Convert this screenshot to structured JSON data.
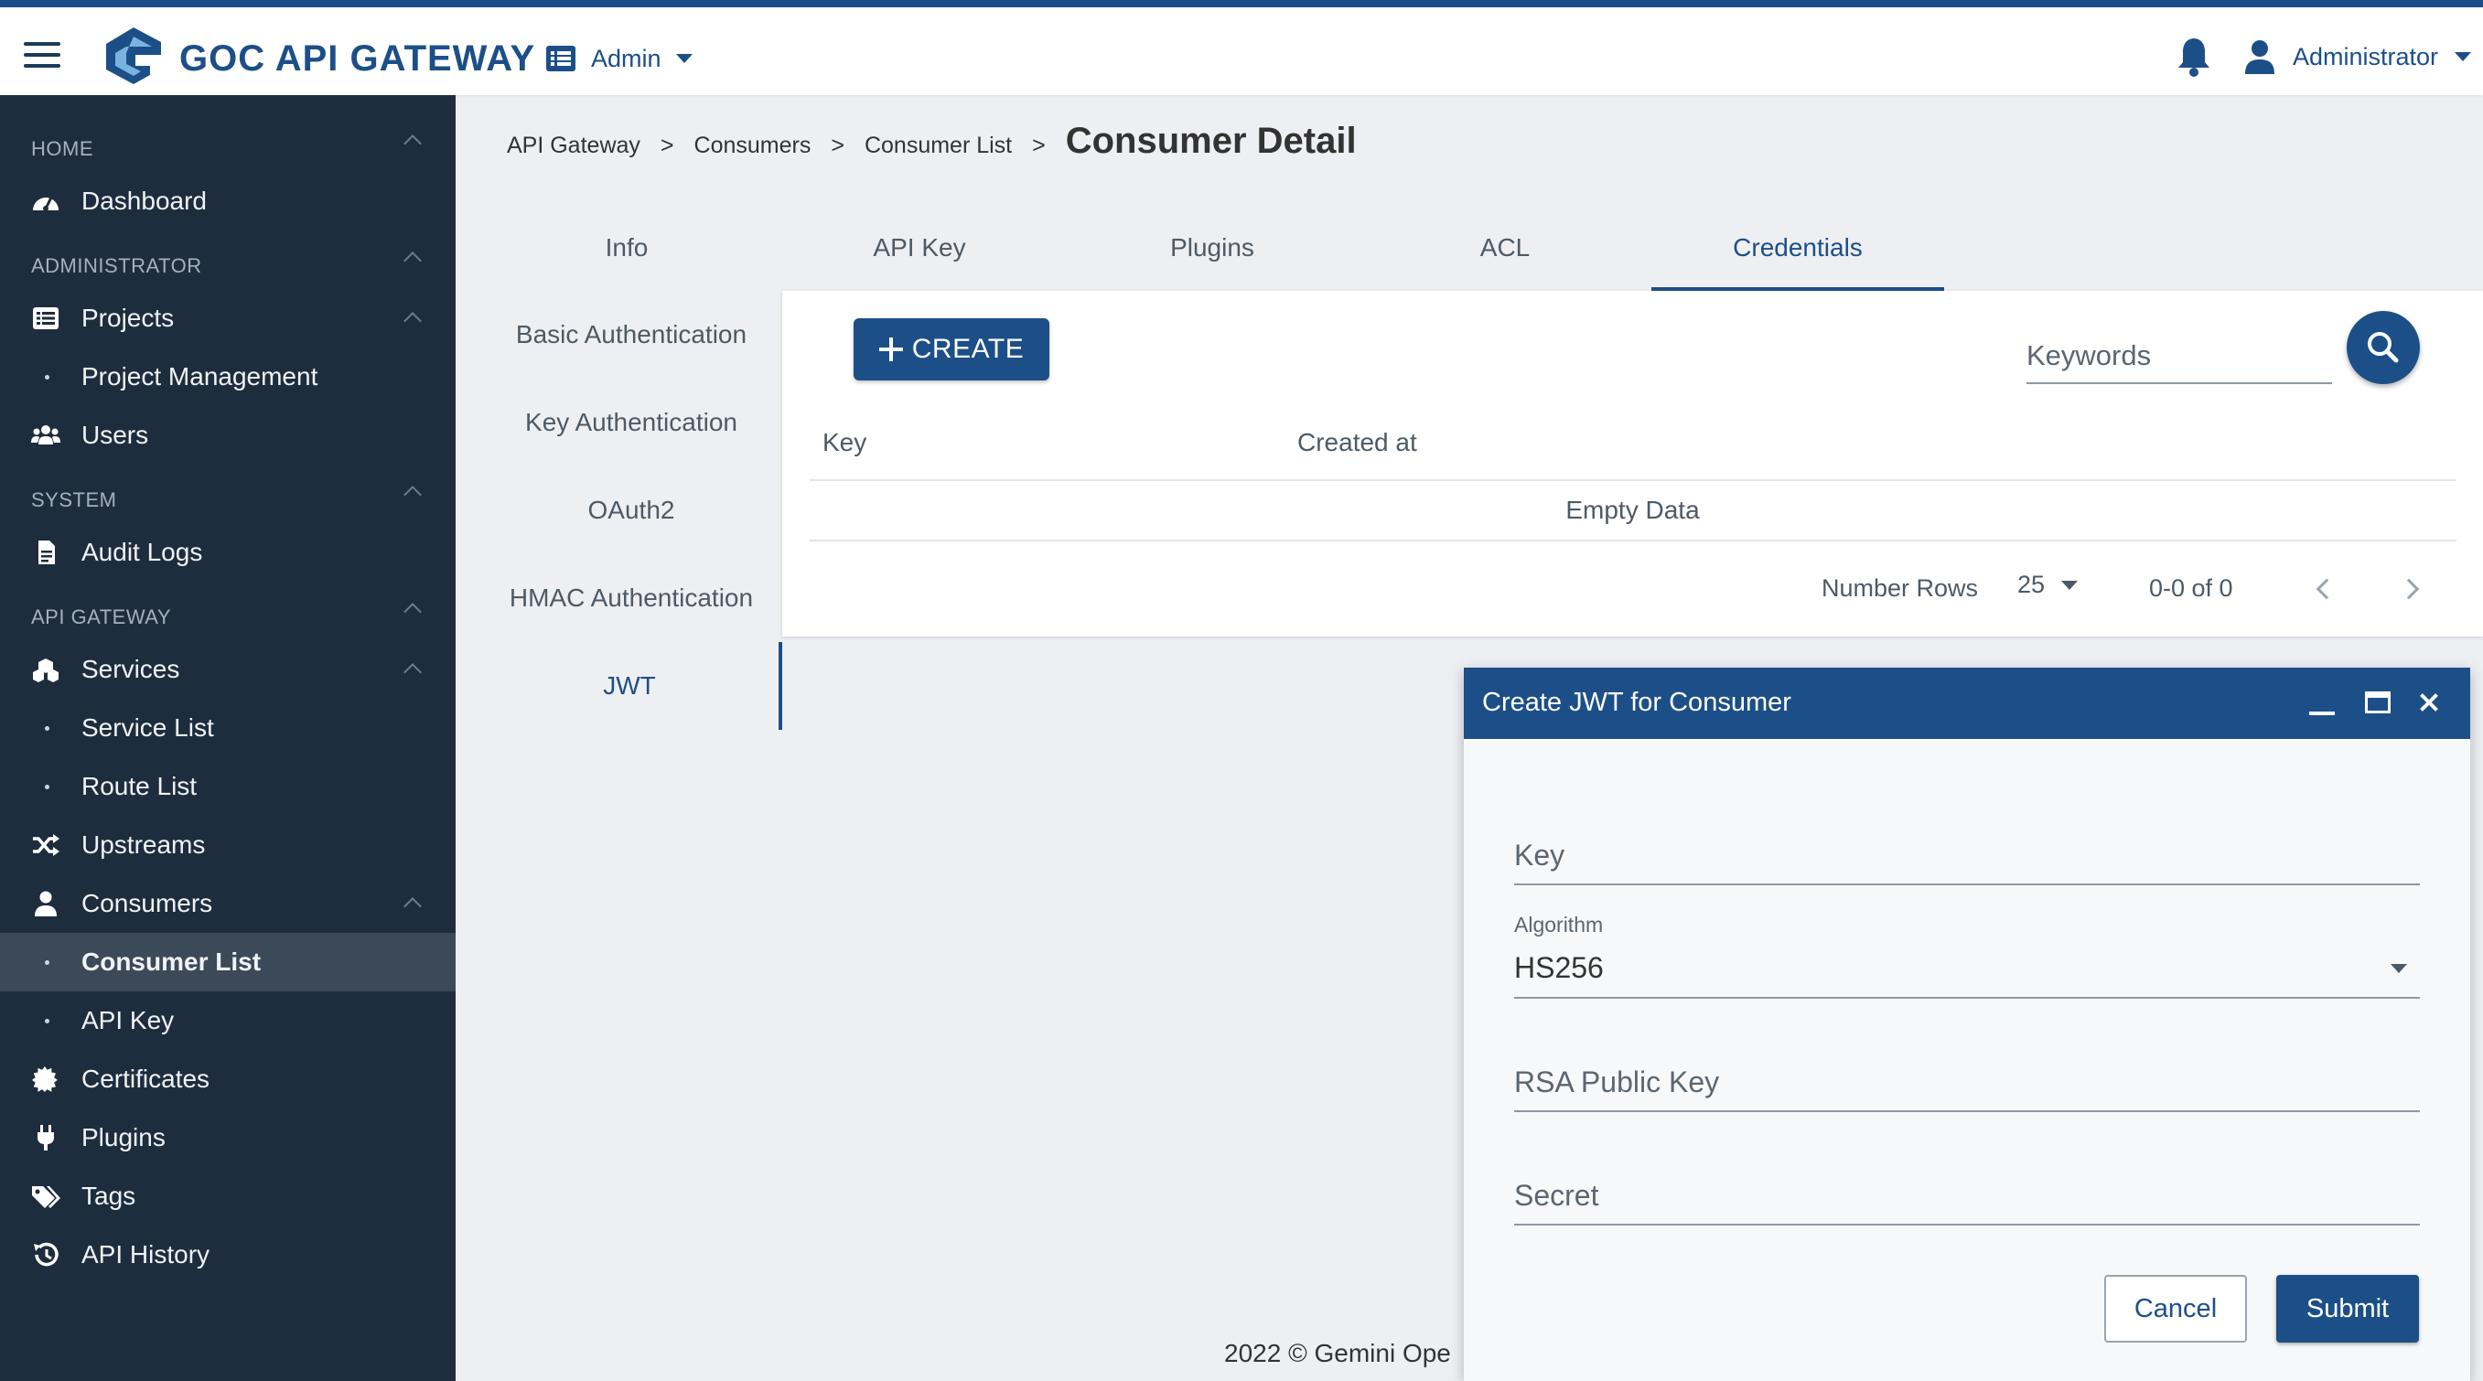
{
  "header": {
    "brand": "GOC API GATEWAY",
    "admin_menu": "Admin",
    "user_menu": "Administrator"
  },
  "sidebar": {
    "sections": [
      {
        "title": "HOME"
      },
      {
        "title": "ADMINISTRATOR"
      },
      {
        "title": "SYSTEM"
      },
      {
        "title": "API GATEWAY"
      }
    ],
    "items": [
      {
        "label": "Dashboard",
        "icon": "dashboard-icon"
      },
      {
        "label": "Projects",
        "icon": "list-icon"
      },
      {
        "label": "Project Management"
      },
      {
        "label": "Users",
        "icon": "users-icon"
      },
      {
        "label": "Audit Logs",
        "icon": "file-icon"
      },
      {
        "label": "Services",
        "icon": "services-icon"
      },
      {
        "label": "Service List"
      },
      {
        "label": "Route List"
      },
      {
        "label": "Upstreams",
        "icon": "shuffle-icon"
      },
      {
        "label": "Consumers",
        "icon": "user-icon"
      },
      {
        "label": "Consumer List",
        "active": true
      },
      {
        "label": "API Key"
      },
      {
        "label": "Certificates",
        "icon": "certificate-icon"
      },
      {
        "label": "Plugins",
        "icon": "plug-icon"
      },
      {
        "label": "Tags",
        "icon": "tags-icon"
      },
      {
        "label": "API History",
        "icon": "history-icon"
      }
    ]
  },
  "breadcrumb": {
    "items": [
      "API Gateway",
      "Consumers",
      "Consumer List"
    ],
    "separator": ">",
    "current": "Consumer Detail"
  },
  "tabs": [
    "Info",
    "API Key",
    "Plugins",
    "ACL",
    "Credentials"
  ],
  "active_tab": "Credentials",
  "vertical_tabs": [
    "Basic Authentication",
    "Key Authentication",
    "OAuth2",
    "HMAC Authentication",
    "JWT"
  ],
  "active_vertical_tab": "JWT",
  "table": {
    "create_label": "CREATE",
    "search_placeholder": "Keywords",
    "columns": [
      "Key",
      "Created at"
    ],
    "empty_text": "Empty Data",
    "rows_label": "Number Rows",
    "rows_per_page": "25",
    "range": "0-0 of 0"
  },
  "footer": "2022 © Gemini Ope",
  "dialog": {
    "title": "Create JWT for Consumer",
    "key_placeholder": "Key",
    "algorithm_label": "Algorithm",
    "algorithm_value": "HS256",
    "rsa_placeholder": "RSA Public Key",
    "secret_placeholder": "Secret",
    "cancel_label": "Cancel",
    "submit_label": "Submit"
  },
  "colors": {
    "primary": "#1c4f88",
    "sidebar_bg": "#1e2d3e",
    "sidebar_active": "#3b4959",
    "page_bg": "#eeeff2"
  }
}
